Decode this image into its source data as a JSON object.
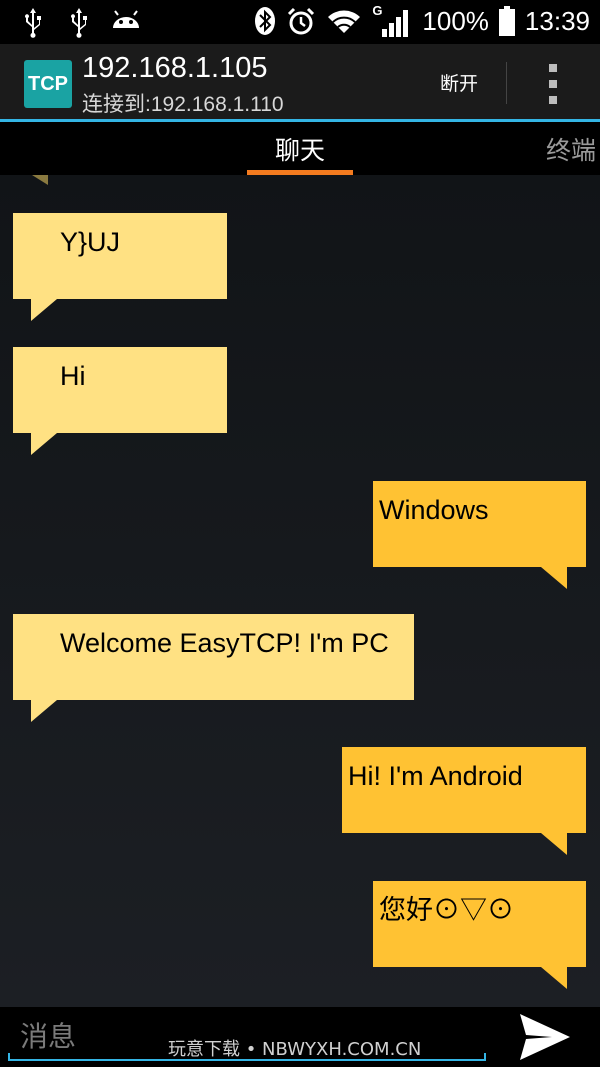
{
  "status_bar": {
    "battery": "100%",
    "time": "13:39",
    "network": "G",
    "icons": [
      "usb-icon",
      "usb-icon",
      "android-debug-icon",
      "bluetooth-icon",
      "alarm-icon",
      "wifi-icon",
      "signal-icon",
      "battery-icon"
    ]
  },
  "action_bar": {
    "app_icon_label": "TCP",
    "title": "192.168.1.105",
    "subtitle": "连接到:192.168.1.110",
    "disconnect_label": "断开"
  },
  "tabs": {
    "chat": "聊天",
    "terminal": "终端"
  },
  "messages": [
    {
      "direction": "incoming",
      "text": "Y}UJ"
    },
    {
      "direction": "incoming",
      "text": "Hi"
    },
    {
      "direction": "outgoing",
      "text": "Windows"
    },
    {
      "direction": "incoming",
      "text": "Welcome EasyTCP! I'm PC"
    },
    {
      "direction": "outgoing",
      "text": "Hi! I'm Android"
    },
    {
      "direction": "outgoing",
      "text": "您好⊙▽⊙"
    }
  ],
  "input": {
    "placeholder": "消息",
    "value": ""
  },
  "watermark": "玩意下载 • NBWYXH.COM.CN",
  "colors": {
    "accent_blue": "#34b5e5",
    "tab_indicator": "#f47b1f",
    "incoming_bubble": "#ffe183",
    "outgoing_bubble": "#ffc233",
    "app_icon": "#1aa3a3"
  }
}
